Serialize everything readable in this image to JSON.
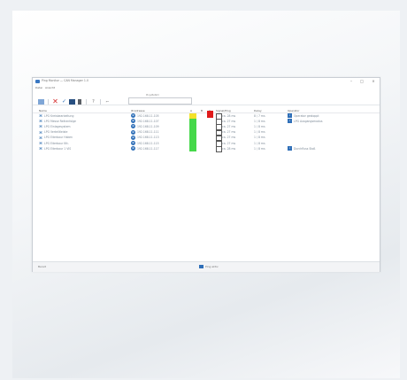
{
  "window": {
    "title": "Ping Monitor — CAN Manager 1.0"
  },
  "menu": [
    "Datei",
    "Ansicht"
  ],
  "toolbar": {
    "cmd_label": "Ping-Befehl"
  },
  "columns": {
    "name": "Name",
    "ip": "IP-Adresse",
    "a": "A",
    "b": "B",
    "c": "C",
    "signal": "Signal/Ping",
    "delay": "Delay",
    "operator": "Operator"
  },
  "rows": [
    {
      "name": "LPG Kreisbearbeitung",
      "ip": "192.168.11.105",
      "signal": "ca. 28 ms",
      "delay": "8 / 7 ms",
      "operator": "Operator gestoppt",
      "status": "red"
    },
    {
      "name": "LPG Messe Reihenfolge",
      "ip": "192.168.11.107",
      "signal": "ca. 27 ms",
      "delay": "1 / 8 ms",
      "operator": "LPG Ausgangsmodus",
      "status": "green"
    },
    {
      "name": "LPG Einlagesystem",
      "ip": "192.168.11.109",
      "signal": "ca. 27 ms",
      "delay": "1 / 8 ms",
      "operator": "",
      "status": "green"
    },
    {
      "name": "LPG Verteiltleiste",
      "ip": "192.168.11.111",
      "signal": "ca. 27 ms",
      "delay": "1 / 8 ms",
      "operator": "",
      "status": "green"
    },
    {
      "name": "LPG Eiterbaur Haken",
      "ip": "192.168.11.113",
      "signal": "ca. 27 ms",
      "delay": "1 / 8 ms",
      "operator": "",
      "status": "green"
    },
    {
      "name": "LPG Eiterbaur Ktt.",
      "ip": "192.168.11.115",
      "signal": "ca. 27 ms",
      "delay": "1 / 8 ms",
      "operator": "",
      "status": "green"
    },
    {
      "name": "LPG Eiterbaur 1 VIS",
      "ip": "192.168.11.117",
      "signal": "ca. 28 ms",
      "delay": "1 / 8 ms",
      "operator": "Durchfluss Stoß",
      "status": "green"
    }
  ],
  "statusbar": {
    "left": "Bereit",
    "mid": "Ping aktiv"
  }
}
